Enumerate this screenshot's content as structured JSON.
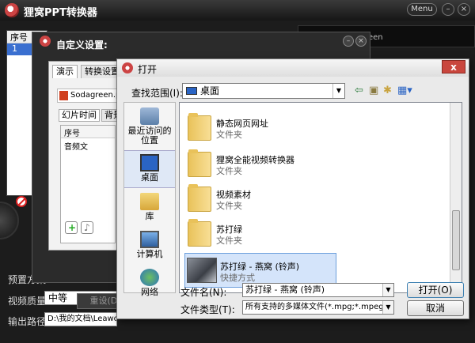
{
  "app": {
    "title": "狸窝PPT转换器",
    "menu_label": "Menu",
    "list_header": "序号",
    "row1": "1",
    "right_panel_text": "een",
    "preset_label": "预置方案",
    "quality_label": "视频质量:",
    "quality_value": "中等",
    "output_label": "输出路径:",
    "output_value": "D:\\我的文档\\Leawo\\P"
  },
  "custom_dialog": {
    "title": "自定义设置:",
    "tabs": [
      "演示",
      "转换设置"
    ],
    "file_name": "Sodagreen.pp",
    "subtabs": [
      "幻片时间",
      "背景"
    ],
    "list_headers": [
      "序号",
      "音频文"
    ],
    "reset_label": "重设(D)"
  },
  "open_dialog": {
    "title": "打开",
    "close_label": "x",
    "lookin_label": "查找范围(I):",
    "lookin_value": "桌面",
    "places": [
      {
        "label": "最近访问的位置",
        "icon": "recent-places-icon"
      },
      {
        "label": "桌面",
        "icon": "desktop-icon"
      },
      {
        "label": "库",
        "icon": "library-icon"
      },
      {
        "label": "计算机",
        "icon": "computer-icon"
      },
      {
        "label": "网络",
        "icon": "network-icon"
      }
    ],
    "files": [
      {
        "name": "静态网页网址",
        "type": "文件夹"
      },
      {
        "name": "狸窝全能视频转换器",
        "type": "文件夹"
      },
      {
        "name": "视频素材",
        "type": "文件夹"
      },
      {
        "name": "苏打绿",
        "type": "文件夹"
      },
      {
        "name": "苏打绿 - 燕窝 (铃声)",
        "type": "快捷方式"
      }
    ],
    "filename_label": "文件名(N):",
    "filename_value": "苏打绿 - 燕窝 (铃声)",
    "filetype_label": "文件类型(T):",
    "filetype_value": "所有支持的多媒体文件(*.mpg;*.mpeg;*.w",
    "open_label": "打开(O)",
    "cancel_label": "取消"
  }
}
